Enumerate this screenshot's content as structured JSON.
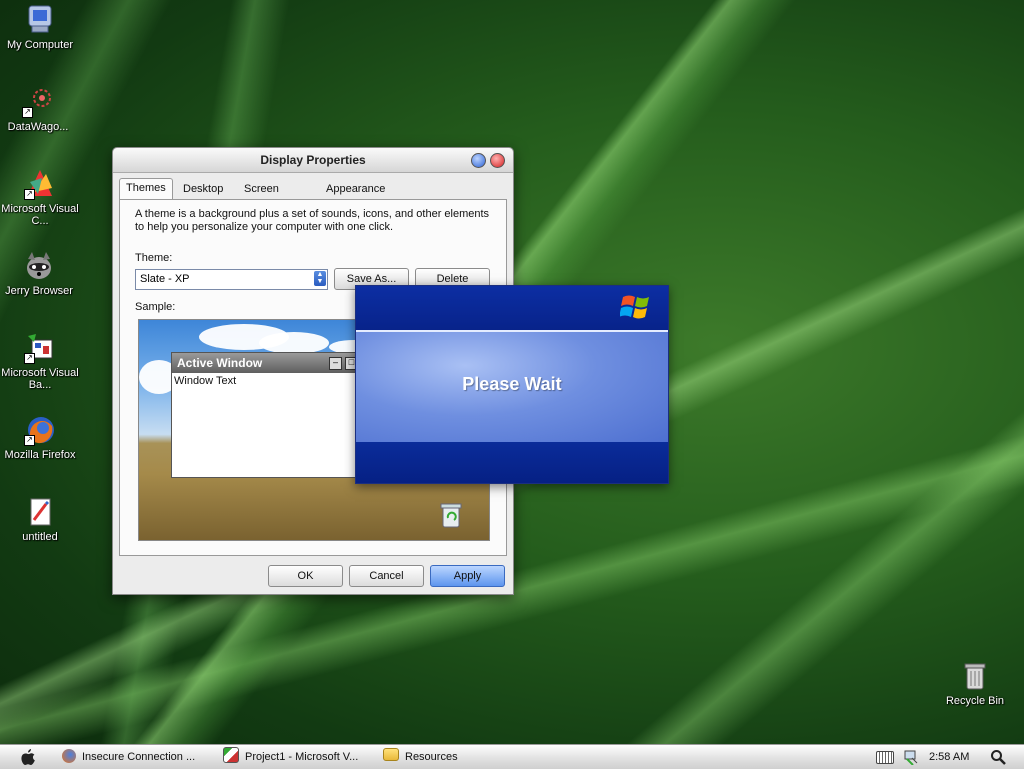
{
  "desktop": {
    "icons": [
      {
        "label": "My Computer",
        "icon": "my-computer-icon"
      },
      {
        "label": "DataWago...",
        "icon": "datawagon-icon"
      },
      {
        "label": "Microsoft Visual C...",
        "icon": "visual-c-icon"
      },
      {
        "label": "Jerry Browser",
        "icon": "raccoon-icon"
      },
      {
        "label": "Microsoft Visual Ba...",
        "icon": "visual-basic-icon"
      },
      {
        "label": "Mozilla Firefox",
        "icon": "firefox-icon"
      },
      {
        "label": "untitled",
        "icon": "document-icon"
      }
    ],
    "recycle_bin": {
      "label": "Recycle Bin",
      "icon": "recycle-bin-icon"
    }
  },
  "display_properties": {
    "title": "Display Properties",
    "tabs": [
      "Themes",
      "Desktop",
      "Screen Saver",
      "Appearance"
    ],
    "active_tab": "Themes",
    "description": "A theme is a background plus a set of sounds, icons, and other elements to help you personalize your computer with one click.",
    "theme_label": "Theme:",
    "theme_value": "Slate - XP",
    "save_as_label": "Save As...",
    "delete_label": "Delete",
    "sample_label": "Sample:",
    "sample_window_title": "Active Window",
    "sample_window_text": "Window Text",
    "ok_label": "OK",
    "cancel_label": "Cancel",
    "apply_label": "Apply"
  },
  "please_wait": {
    "message": "Please Wait"
  },
  "taskbar": {
    "items": [
      {
        "label": "Insecure Connection ...",
        "icon": "firefox-icon"
      },
      {
        "label": "Project1 - Microsoft V...",
        "icon": "visual-basic-icon"
      },
      {
        "label": "Resources",
        "icon": "folder-icon"
      }
    ],
    "clock": "2:58 AM"
  },
  "colors": {
    "accent_blue": "#0a2a94",
    "apply_button": "#5d95ee"
  }
}
